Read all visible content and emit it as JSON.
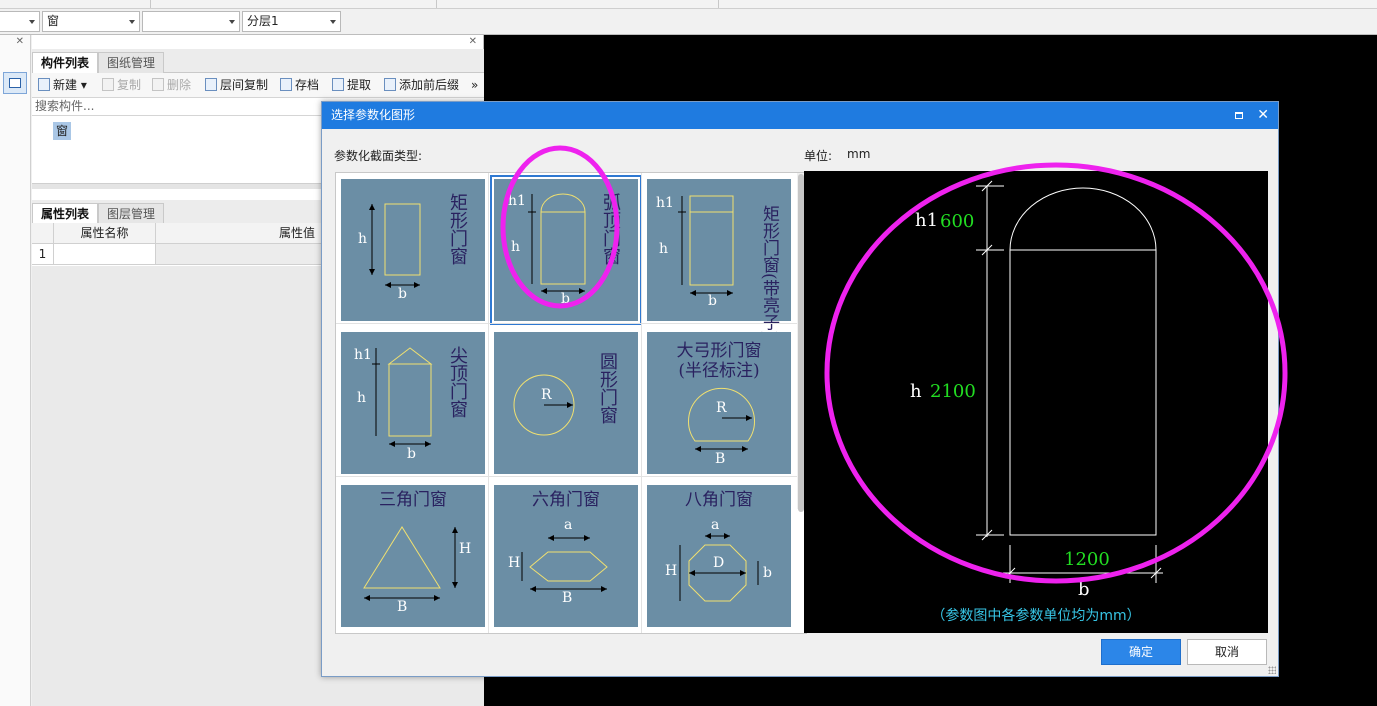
{
  "top_combos": [
    {
      "value": ""
    },
    {
      "value": "窗"
    },
    {
      "value": ""
    },
    {
      "value": "分层1"
    }
  ],
  "left_panel": {
    "tabs": [
      "构件列表",
      "图纸管理"
    ],
    "toolbar": {
      "new": "新建",
      "copy": "复制",
      "delete": "删除",
      "floor_copy": "层间复制",
      "save": "存档",
      "extract": "提取",
      "add_prefix": "添加前后缀"
    },
    "search_placeholder": "搜索构件...",
    "tree_item": "窗",
    "prop_tabs": [
      "属性列表",
      "图层管理"
    ],
    "prop_headers": {
      "name": "属性名称",
      "value": "属性值"
    },
    "row_number": "1"
  },
  "dialog": {
    "title": "选择参数化图形",
    "section_label": "参数化截面类型:",
    "unit_label": "单位:",
    "unit_value": "mm",
    "shapes": [
      {
        "title": "矩形门窗",
        "dims": [
          "h",
          "b"
        ],
        "icon": "rect-window-icon"
      },
      {
        "title": "弧顶门窗",
        "dims": [
          "h1",
          "h",
          "b"
        ],
        "icon": "arch-window-icon",
        "selected": true
      },
      {
        "title": "矩形门窗(带亮子)",
        "dims": [
          "h1",
          "h",
          "b"
        ],
        "icon": "rect-transom-window-icon"
      },
      {
        "title": "尖顶门窗",
        "dims": [
          "h1",
          "h",
          "b"
        ],
        "icon": "pointed-window-icon"
      },
      {
        "title": "圆形门窗",
        "dims": [
          "R"
        ],
        "icon": "circle-window-icon"
      },
      {
        "title": "大弓形门窗",
        "subtitle": "(半径标注)",
        "dims": [
          "R",
          "B"
        ],
        "icon": "segment-window-icon"
      },
      {
        "title": "三角门窗",
        "dims": [
          "H",
          "B"
        ],
        "icon": "triangle-window-icon"
      },
      {
        "title": "六角门窗",
        "dims": [
          "a",
          "H",
          "B"
        ],
        "icon": "hexagon-window-icon"
      },
      {
        "title": "八角门窗",
        "dims": [
          "a",
          "H",
          "D",
          "b"
        ],
        "icon": "octagon-window-icon"
      }
    ],
    "preview": {
      "h1_label": "h1",
      "h1_value": "600",
      "h_label": "h",
      "h_value": "2100",
      "b_label": "b",
      "b_value": "1200",
      "note": "（参数图中各参数单位均为mm）"
    },
    "ok_button": "确定",
    "cancel_button": "取消"
  },
  "colors": {
    "title_bar": "#1f7be0",
    "tile_bg": "#6b8ea5",
    "shape_stroke": "#f0e070",
    "dim_value": "#22dd22",
    "note_text": "#37c6e6",
    "annotation": "#ee22ee"
  }
}
